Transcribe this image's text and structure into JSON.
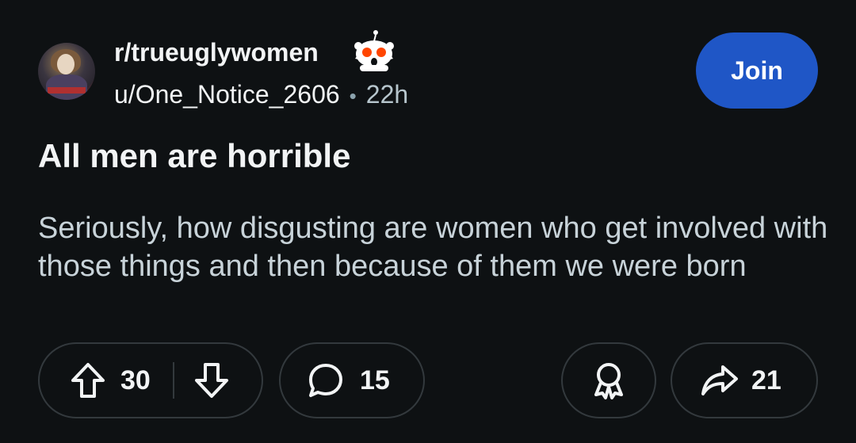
{
  "post": {
    "subreddit": "r/trueuglywomen",
    "username": "u/One_Notice_2606",
    "separator": "•",
    "age": "22h",
    "join_label": "Join",
    "title": "All men are horrible",
    "body": "Seriously, how disgusting are women who get involved with those things and then because of them we were born"
  },
  "actions": {
    "upvotes": "30",
    "comments": "15",
    "shares": "21"
  },
  "icons": {
    "avatar": "subreddit-avatar",
    "mascot": "reddit-snoo-shocked-icon",
    "upvote": "upvote-arrow-icon",
    "downvote": "downvote-arrow-icon",
    "comment": "comment-bubble-icon",
    "award": "award-ribbon-icon",
    "share": "share-arrow-icon"
  },
  "colors": {
    "background": "#0e1113",
    "join_button": "#1f56c6",
    "pill_border": "#33393d",
    "body_text": "#c8d3d9",
    "mascot_red": "#ff4500"
  }
}
